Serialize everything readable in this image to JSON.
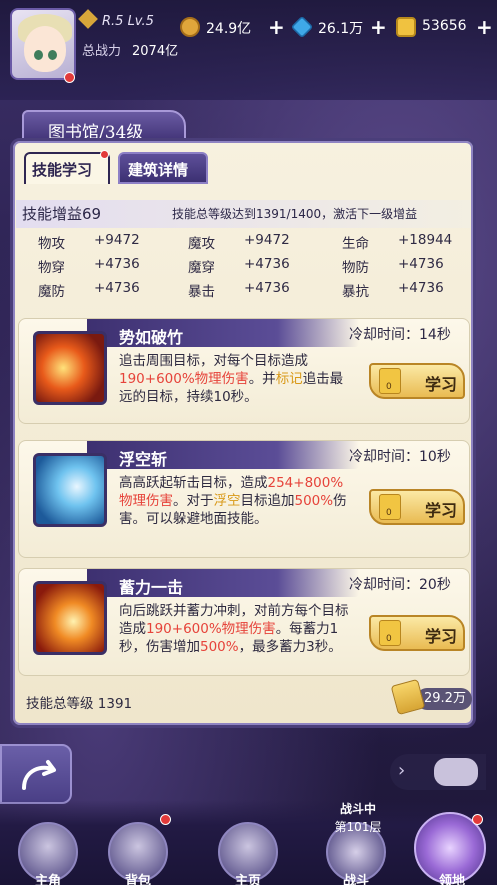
{
  "player": {
    "rank": "R.5 Lv.5",
    "power_label": "总战力",
    "power_value": "2074亿"
  },
  "resources": [
    {
      "value": "24.9亿",
      "color": "#e0a63b"
    },
    {
      "value": "26.1万",
      "color": "#3fa8e8"
    },
    {
      "value": "53656",
      "color": "#f0c240"
    }
  ],
  "resource_plus": "+",
  "library": {
    "title": "图书馆/34级",
    "tabs": [
      "技能学习",
      "建筑详情"
    ]
  },
  "stats": {
    "title": "技能增益69",
    "note": "技能总等级达到1391/1400，激活下一级增益",
    "rows": [
      [
        {
          "k": "物攻",
          "v": "+9472"
        },
        {
          "k": "魔攻",
          "v": "+9472"
        },
        {
          "k": "生命",
          "v": "+18944"
        }
      ],
      [
        {
          "k": "物穿",
          "v": "+4736"
        },
        {
          "k": "魔穿",
          "v": "+4736"
        },
        {
          "k": "物防",
          "v": "+4736"
        }
      ],
      [
        {
          "k": "魔防",
          "v": "+4736"
        },
        {
          "k": "暴击",
          "v": "+4736"
        },
        {
          "k": "暴抗",
          "v": "+4736"
        }
      ]
    ]
  },
  "skills": [
    {
      "name": "势如破竹",
      "cooldown": "冷却时间：14秒",
      "learn": "学习",
      "count": "0"
    },
    {
      "name": "浮空斩",
      "cooldown": "冷却时间：10秒",
      "learn": "学习",
      "count": "0"
    },
    {
      "name": "蓄力一击",
      "cooldown": "冷却时间：20秒",
      "learn": "学习",
      "count": "0"
    }
  ],
  "desc1": {
    "a": "追击周围目标，对每个目标造成",
    "b": "190+600%物理伤害",
    "c": "。并",
    "d": "标记",
    "e": "追击最远的目标，持续10秒。"
  },
  "desc2": {
    "a": "高高跃起斩击目标，造成",
    "b": "254+800%物理伤害",
    "c": "。对于",
    "d": "浮空",
    "e": "目标追加",
    "f": "500%",
    "g": "伤害。可以躲避地面技能。"
  },
  "desc3": {
    "a": "向后跳跃并蓄力冲刺，对前方每个目标造成",
    "b": "190+600%物理伤害",
    "c": "。每蓄力1秒，伤害增加",
    "d": "500%",
    "e": "，最多蓄力3秒。"
  },
  "total": {
    "label": "技能总等级 1391",
    "cost": "29.2万"
  },
  "nav": {
    "items": [
      "主角",
      "背包",
      "主页",
      "战斗",
      "领地"
    ],
    "battle_status": "战斗中",
    "battle_level": "第101层"
  },
  "icons": {
    "back": "curve-arrow-icon",
    "chat": "chat-bubble-icon"
  }
}
